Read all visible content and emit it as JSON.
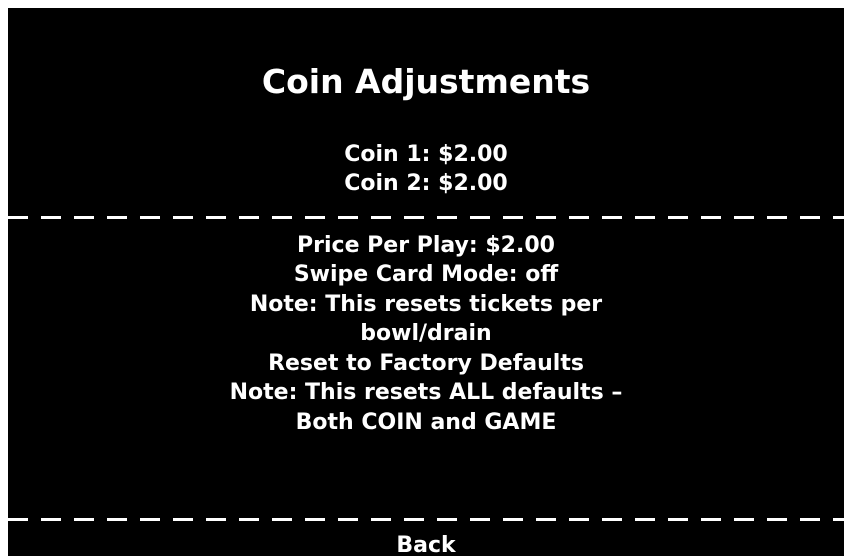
{
  "screen": {
    "title": "Coin Adjustments",
    "coins": [
      {
        "label": "Coin 1: $2.00"
      },
      {
        "label": "Coin 2: $2.00"
      }
    ],
    "settings": {
      "price_per_play": "Price Per Play: $2.00",
      "swipe_card_mode": "Swipe Card Mode: off",
      "note_tickets_line1": "Note: This resets tickets per",
      "note_tickets_line2": "bowl/drain",
      "reset_factory": "Reset to Factory Defaults",
      "note_all_line1": "Note: This resets ALL defaults –",
      "note_all_line2": "Both COIN and GAME"
    },
    "back_label": "Back"
  },
  "colors": {
    "background": "#000000",
    "text": "#ffffff",
    "border": "#ffffff"
  }
}
